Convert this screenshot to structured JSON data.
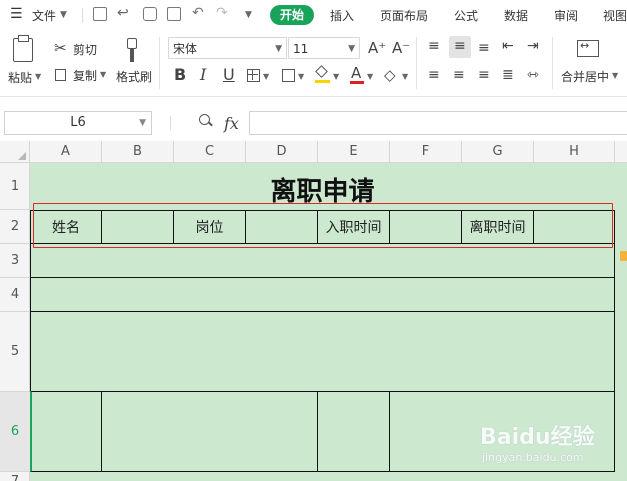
{
  "menu": {
    "file_label": "文件",
    "tabs": [
      "开始",
      "插入",
      "页面布局",
      "公式",
      "数据",
      "审阅",
      "视图"
    ]
  },
  "ribbon": {
    "paste": "粘贴",
    "cut": "剪切",
    "copy": "复制",
    "format_painter": "格式刷",
    "font_name": "宋体",
    "font_size": "11",
    "merge_center": "合并居中"
  },
  "formula_bar": {
    "cell_ref": "L6",
    "fx": "fx",
    "content": ""
  },
  "sheet": {
    "columns": [
      "A",
      "B",
      "C",
      "D",
      "E",
      "F",
      "G",
      "H"
    ],
    "rows": [
      "1",
      "2",
      "3",
      "4",
      "5",
      "6",
      "7"
    ],
    "title": "离职申请",
    "row2": [
      "姓名",
      "",
      "岗位",
      "",
      "入职时间",
      "",
      "离职时间",
      ""
    ],
    "fill_color": "#cce8cf",
    "highlight_color": "#e0262b"
  },
  "watermark": {
    "brand": "Baidu经验",
    "url": "jingyan.baidu.com"
  }
}
